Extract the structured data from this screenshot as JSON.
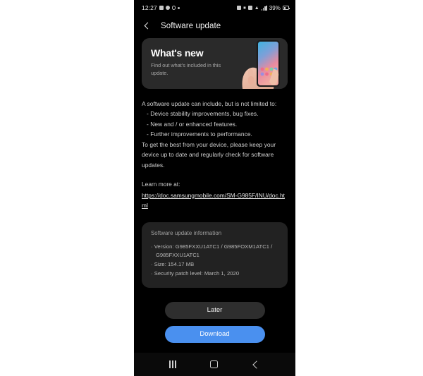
{
  "status_bar": {
    "time": "12:27",
    "battery_percent": "39%",
    "left_icons": [
      "screenshot-icon",
      "gear-icon",
      "clock-icon",
      "dot-icon"
    ],
    "right_icons": [
      "nfc-icon",
      "mute-icon",
      "wifi-icon",
      "signal-icon",
      "signal-bars-icon",
      "battery-icon"
    ]
  },
  "app_bar": {
    "title": "Software update",
    "back_label": "Back"
  },
  "hero": {
    "title": "What's new",
    "subtitle": "Find out what's included in this update."
  },
  "body": {
    "intro": "A software update can include, but is not limited to:",
    "bullets": [
      "- Device stability improvements, bug fixes.",
      "- New and / or enhanced features.",
      "- Further improvements to performance."
    ],
    "outro": "To get the best from your device, please keep your device up to date and regularly check for software updates.",
    "learn_more_label": "Learn more at:",
    "learn_more_url": "https://doc.samsungmobile.com/SM-G985F/INU/doc.html"
  },
  "info_panel": {
    "heading": "Software update information",
    "version_line1": "· Version: G985FXXU1ATC1 / G985FOXM1ATC1 /",
    "version_line2": "G985FXXU1ATC1",
    "size": "· Size: 154.17 MB",
    "security": "· Security patch level: March 1, 2020"
  },
  "actions": {
    "later_label": "Later",
    "download_label": "Download",
    "download_color": "#4a90ef"
  },
  "nav_bar": {
    "recents_label": "Recents",
    "home_label": "Home",
    "back_label": "Back"
  }
}
